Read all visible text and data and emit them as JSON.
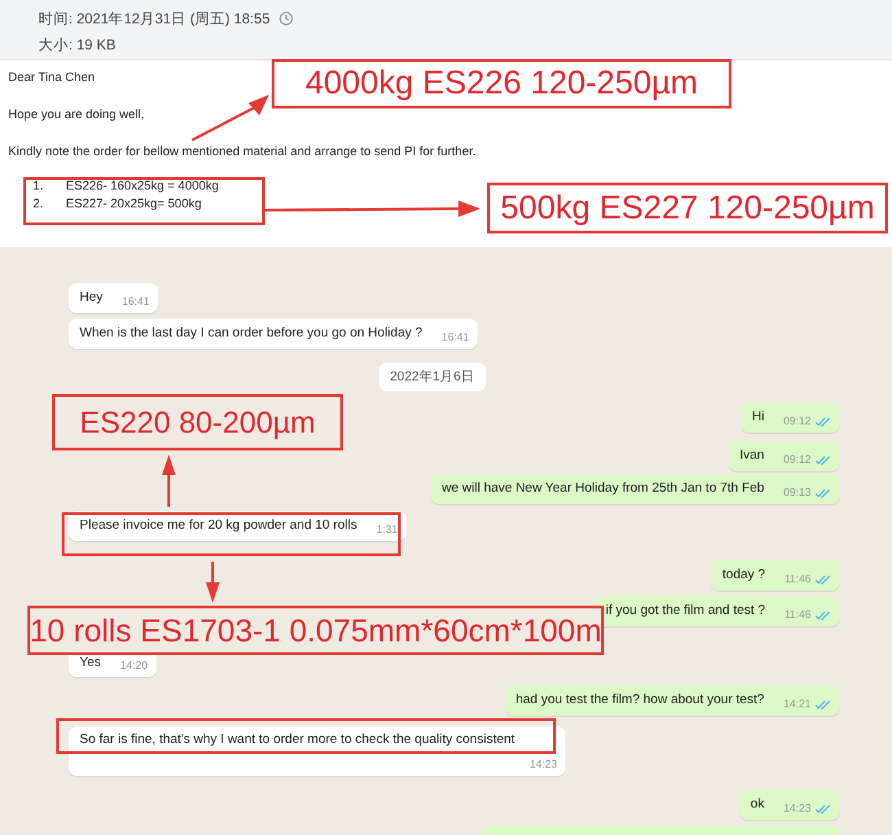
{
  "email": {
    "time_label": "时间: 2021年12月31日 (周五) 18:55",
    "size_label": "大小: 19 KB",
    "greeting": "Dear Tina Chen",
    "lines": [
      "Hope you are doing well,",
      "Kindly note the order for bellow mentioned material and arrange to send PI for further."
    ],
    "order_items": [
      {
        "number": "1.",
        "text": "ES226- 160x25kg = 4000kg"
      },
      {
        "number": "2.",
        "text": "ES227- 20x25kg= 500kg"
      }
    ]
  },
  "chat": {
    "messages": [
      {
        "kind": "incoming",
        "text": "Hey",
        "time": "16:41"
      },
      {
        "kind": "incoming",
        "text": "When is the last day I can order before you go on Holiday ?",
        "time": "16:41"
      },
      {
        "kind": "date",
        "text": "2022年1月6日"
      },
      {
        "kind": "outgoing",
        "text": "Hi",
        "time": "09:12",
        "read": true
      },
      {
        "kind": "outgoing",
        "text": "Ivan",
        "time": "09:12",
        "read": true
      },
      {
        "kind": "outgoing",
        "text": "we will have New Year Holiday from 25th Jan to 7th Feb",
        "time": "09:13",
        "read": true
      },
      {
        "kind": "incoming",
        "text": "Please invoice me for 20 kg powder and 10 rolls",
        "time": "1:31"
      },
      {
        "kind": "outgoing",
        "text": "today ?",
        "time": "11:46",
        "read": true
      },
      {
        "kind": "outgoing",
        "text": "if you got the film and test ?",
        "time": "11:46",
        "read": true
      },
      {
        "kind": "incoming",
        "text": "Yes",
        "time": "14:20"
      },
      {
        "kind": "outgoing",
        "text": "had you test the film? how about your test?",
        "time": "14:21",
        "read": true
      },
      {
        "kind": "incoming",
        "text": "So far is fine, that's why I want to order more to check the quality consistent",
        "time": "14:23"
      },
      {
        "kind": "outgoing",
        "text": "ok",
        "time": "14:23",
        "read": true
      }
    ]
  },
  "annotations": [
    "4000kg  ES226 120-250µm",
    "500kg  ES227 120-250µm",
    "ES220 80-200µm",
    "10 rolls  ES1703-1 0.075mm*60cm*100m"
  ]
}
